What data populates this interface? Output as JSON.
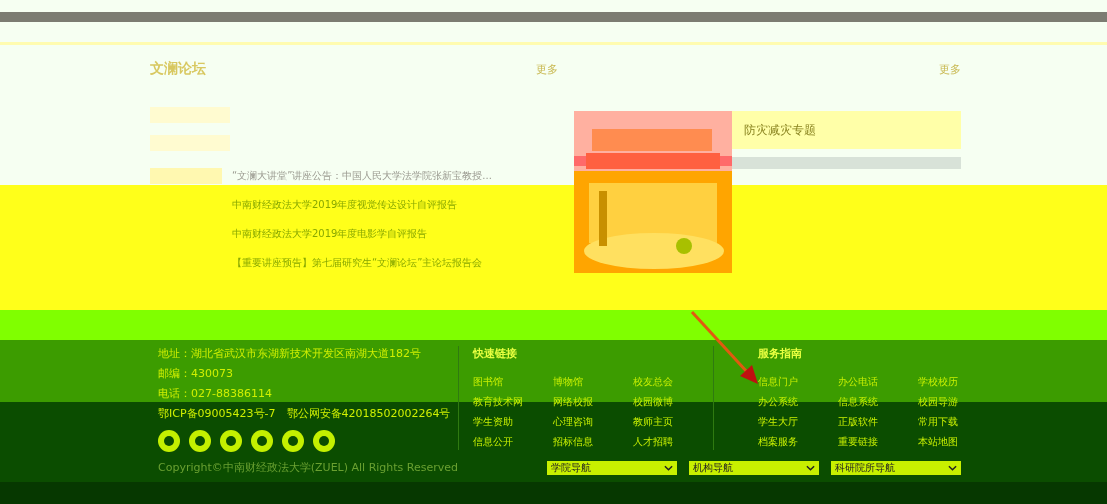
{
  "left_panel": {
    "title": "文澜论坛",
    "more": "更多",
    "news": [
      {
        "text": "“文澜大讲堂”讲座公告：中国人民大学法学院张新宝教授...",
        "badge": true
      },
      {
        "text": "中南财经政法大学2019年度视觉传达设计自评报告",
        "badge": false
      },
      {
        "text": "中南财经政法大学2019年度电影学自评报告",
        "badge": false
      },
      {
        "text": "【重要讲座预告】第七届研究生“文澜论坛”主论坛报告会",
        "badge": false
      }
    ]
  },
  "right_panel": {
    "more": "更多",
    "topics": [
      {
        "text": "防灾减灾专题",
        "selected": true
      }
    ]
  },
  "footer": {
    "contact": [
      "地址：湖北省武汉市东湖新技术开发区南湖大道182号",
      "邮编：430073",
      "电话：027-88386114",
      "鄂ICP备09005423号-7　鄂公网安备42018502002264号"
    ],
    "quick_links": {
      "title": "快速链接",
      "items": [
        "图书馆",
        "博物馆",
        "校友总会",
        "教育技术网",
        "网络校报",
        "校园微博",
        "学生资助",
        "心理咨询",
        "教师主页",
        "信息公开",
        "招标信息",
        "人才招聘"
      ]
    },
    "service": {
      "title": "服务指南",
      "items": [
        "信息门户",
        "办公电话",
        "学校校历",
        "办公系统",
        "信息系统",
        "校园导游",
        "学生大厅",
        "正版软件",
        "常用下载",
        "档案服务",
        "重要链接",
        "本站地图"
      ]
    },
    "copyright": "Copyright©中南财经政法大学(ZUEL) All Rights Reserved",
    "selects": [
      "学院导航",
      "机构导航",
      "科研院所导航"
    ]
  }
}
